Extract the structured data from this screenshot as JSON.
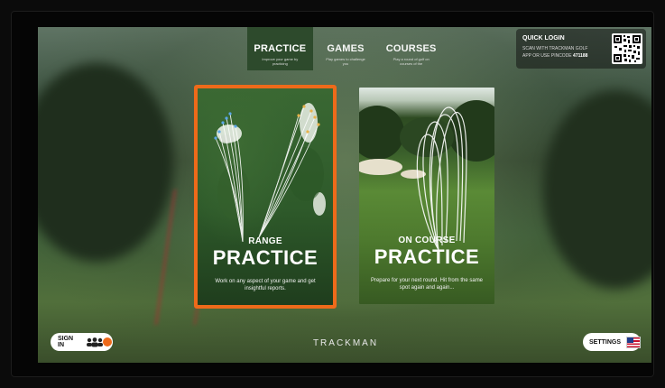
{
  "tabs": [
    {
      "label": "PRACTICE",
      "sub": "Improve your game by practicing",
      "active": true
    },
    {
      "label": "GAMES",
      "sub": "Play games to challenge you",
      "active": false
    },
    {
      "label": "COURSES",
      "sub": "Play a round of golf on courses of the",
      "active": false
    }
  ],
  "quick_login": {
    "title": "QUICK LOGIN",
    "line1": "SCAN WITH TRACKMAN GOLF",
    "line2_prefix": "APP OR USE PINCODE",
    "pincode": "471188"
  },
  "cards": [
    {
      "small": "RANGE",
      "big": "PRACTICE",
      "desc": "Work on any aspect of your game and get insightful reports."
    },
    {
      "small": "ON COURSE",
      "big": "PRACTICE",
      "desc": "Prepare for your next round. Hit from the same spot again and again..."
    }
  ],
  "footer": {
    "signin_label": "SIGN IN",
    "brand": "TRACKMAN",
    "settings_label": "SETTINGS"
  },
  "colors": {
    "accent": "#ee6a1a",
    "active_tab": "#2d4a2c",
    "brand_text": "#e8e8e8"
  }
}
